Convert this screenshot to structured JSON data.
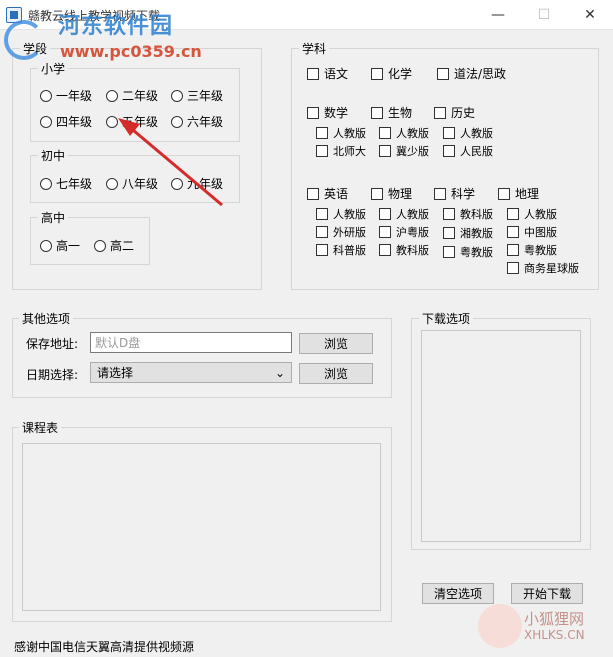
{
  "window": {
    "title": "赣教云线上教学视频下载",
    "minimize": "—",
    "maximize": "☐",
    "close": "✕"
  },
  "watermark": {
    "name": "河东软件园",
    "url": "www.pc0359.cn",
    "corner_name": "小狐狸网",
    "corner_url": "XHLKS.CN"
  },
  "stage": {
    "legend": "学段",
    "primary": {
      "legend": "小学",
      "grades": [
        "一年级",
        "二年级",
        "三年级",
        "四年级",
        "五年级",
        "六年级"
      ]
    },
    "middle": {
      "legend": "初中",
      "grades": [
        "七年级",
        "八年级",
        "九年级"
      ]
    },
    "high": {
      "legend": "高中",
      "grades": [
        "高一",
        "高二"
      ]
    }
  },
  "subjects": {
    "legend": "学科",
    "row1": [
      "语文",
      "化学",
      "道法/思政"
    ],
    "math": "数学",
    "math_editions": [
      "人教版",
      "北师大"
    ],
    "bio": "生物",
    "bio_editions": [
      "人教版",
      "冀少版"
    ],
    "history": "历史",
    "history_editions": [
      "人教版",
      "人民版"
    ],
    "english": "英语",
    "english_editions": [
      "人教版",
      "外研版",
      "科普版"
    ],
    "physics": "物理",
    "physics_editions": [
      "人教版",
      "沪粤版",
      "教科版"
    ],
    "science": "科学",
    "science_editions": [
      "教科版",
      "湘教版",
      "粤教版"
    ],
    "geography": "地理",
    "geography_editions": [
      "人教版",
      "中图版",
      "粤教版",
      "商务星球版"
    ]
  },
  "other": {
    "legend": "其他选项",
    "save_label": "保存地址:",
    "save_placeholder": "默认D盘",
    "browse1": "浏览",
    "date_label": "日期选择:",
    "date_value": "请选择",
    "browse2": "浏览"
  },
  "schedule": {
    "legend": "课程表"
  },
  "download": {
    "legend": "下载选项",
    "clear": "清空选项",
    "start": "开始下载"
  },
  "footer": {
    "thanks": "感谢中国电信天翼高清提供视频源"
  },
  "colors": {
    "accent": "#2b7fd0",
    "arrow": "#d62b2b"
  }
}
